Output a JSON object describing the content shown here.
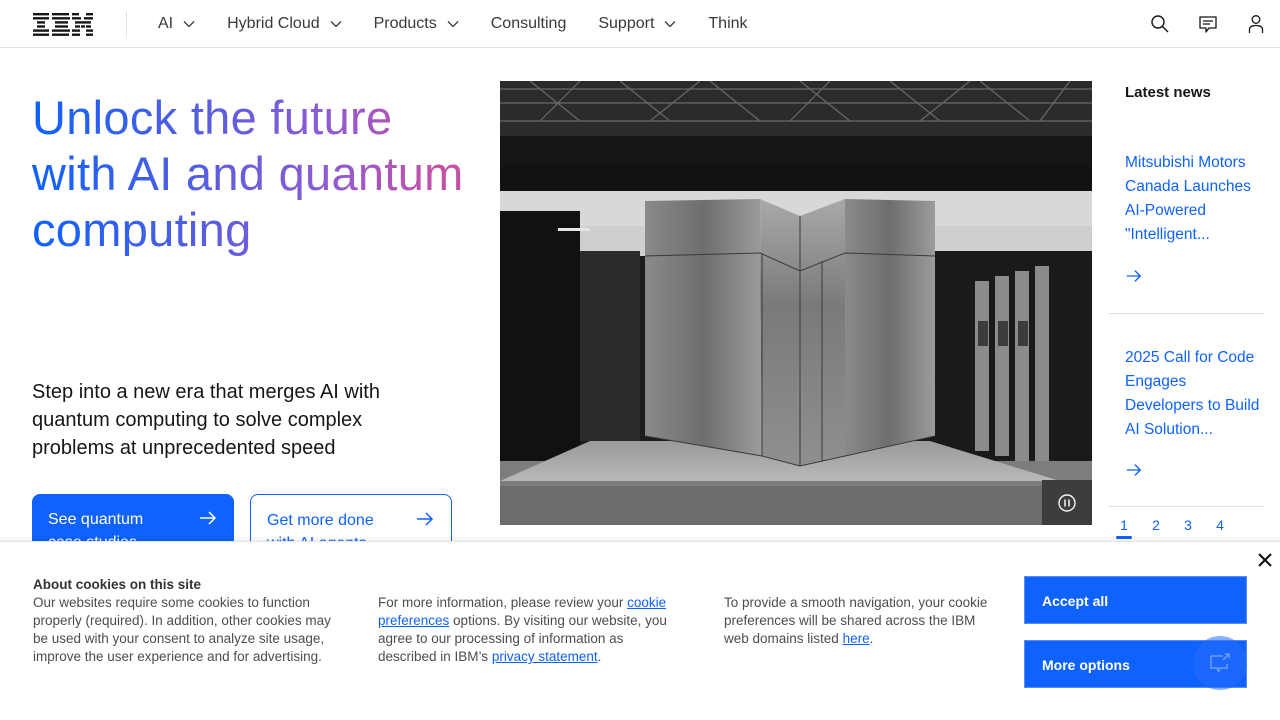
{
  "masthead": {
    "logo_text": "IBM",
    "nav": [
      {
        "label": "AI",
        "has_menu": true
      },
      {
        "label": "Hybrid Cloud",
        "has_menu": true
      },
      {
        "label": "Products",
        "has_menu": true
      },
      {
        "label": "Consulting",
        "has_menu": false
      },
      {
        "label": "Support",
        "has_menu": true
      },
      {
        "label": "Think",
        "has_menu": false
      }
    ],
    "utilities": [
      {
        "icon": "search-icon",
        "label": "Search"
      },
      {
        "icon": "chat-icon",
        "label": "Contact"
      },
      {
        "icon": "user-icon",
        "label": "Profile"
      }
    ]
  },
  "hero": {
    "title": "Unlock the future with AI and quantum computing",
    "subtitle": "Step into a new era that merges AI with quantum computing to solve complex problems at unprecedented speed",
    "cta_primary": {
      "label": "See quantum case studies",
      "icon": "arrow-right-icon"
    },
    "cta_secondary": {
      "label": "Get more done with AI agents",
      "icon": "arrow-right-icon"
    },
    "media": {
      "description": "Quantum computer room with metallic cabinets",
      "control": "pause-icon"
    }
  },
  "news": {
    "heading": "Latest news",
    "items": [
      {
        "title": "Mitsubishi Motors Canada Launches AI-Powered \"Intelligent..."
      },
      {
        "title": "2025 Call for Code Engages Developers to Build AI Solution..."
      }
    ],
    "pages": [
      "1",
      "2",
      "3",
      "4"
    ],
    "active_page": "1"
  },
  "cookie_banner": {
    "title": "About cookies on this site",
    "col1_text": "Our websites require some cookies to function properly (required). In addition, other cookies may be used with your consent to analyze site usage, improve the user experience and for advertising.",
    "col2_pre": "For more information, please review your ",
    "col2_link1": "cookie preferences",
    "col2_mid": " options. By visiting our website, you agree to our processing of information as described in IBM’s ",
    "col2_link2": "privacy statement",
    "col2_post": ".",
    "col3_pre": "To provide a smooth navigation, your cookie preferences will be shared across the IBM web domains listed ",
    "col3_link": "here",
    "col3_post": ".",
    "accept_label": "Accept all",
    "more_label": "More options"
  },
  "colors": {
    "brand_blue": "#0f62fe",
    "title_gradient_end": "#c451a6",
    "text_primary": "#161616"
  }
}
